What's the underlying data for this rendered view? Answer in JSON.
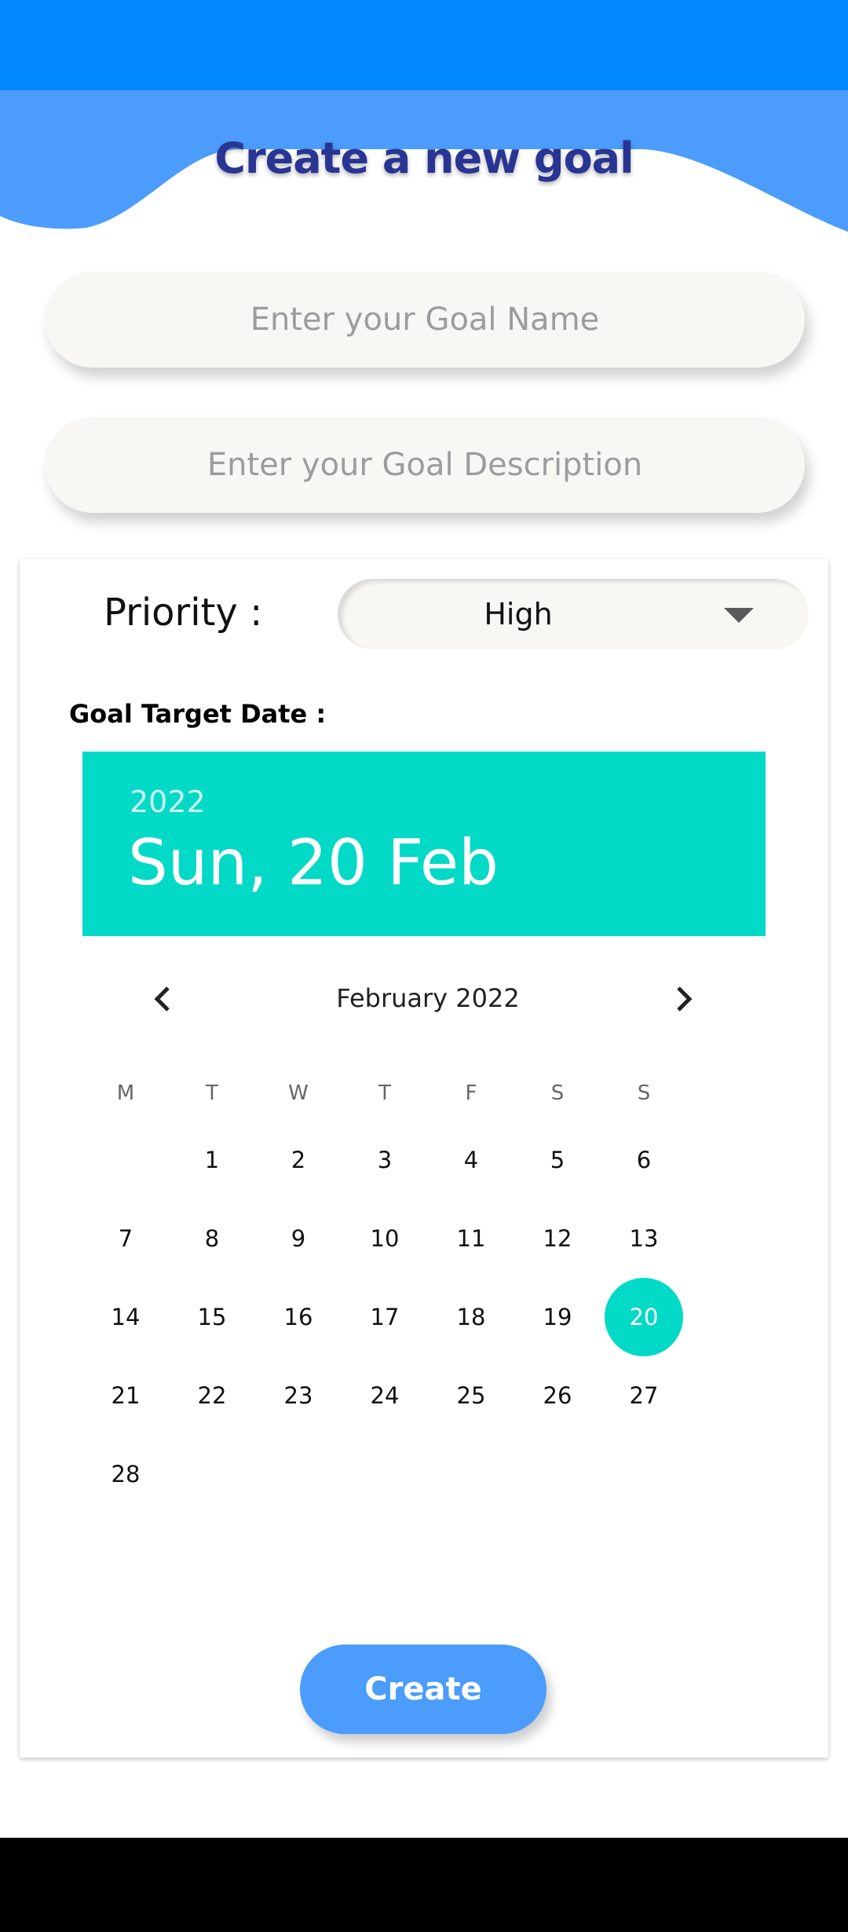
{
  "page": {
    "title": "Create a new goal"
  },
  "form": {
    "goal_name_placeholder": "Enter your Goal Name",
    "goal_description_placeholder": "Enter your Goal Description",
    "priority_label": "Priority :",
    "priority_value": "High",
    "date_label": "Goal Target Date :",
    "create_label": "Create"
  },
  "calendar": {
    "selected_year": "2022",
    "selected_date": "Sun, 20 Feb",
    "month_label": "February 2022",
    "prev_icon": "chevron-left-icon",
    "next_icon": "chevron-right-icon",
    "weekdays": [
      "M",
      "T",
      "W",
      "T",
      "F",
      "S",
      "S"
    ],
    "days": [
      "1",
      "2",
      "3",
      "4",
      "5",
      "6",
      "7",
      "8",
      "9",
      "10",
      "11",
      "12",
      "13",
      "14",
      "15",
      "16",
      "17",
      "18",
      "19",
      "20",
      "21",
      "22",
      "23",
      "24",
      "25",
      "26",
      "27",
      "28"
    ],
    "selected_day": "20"
  },
  "colors": {
    "status_bar": "#0288fe",
    "wave": "#4b9cfb",
    "title": "#283593",
    "accent_teal": "#02d9c6",
    "button": "#4b9cfb"
  }
}
